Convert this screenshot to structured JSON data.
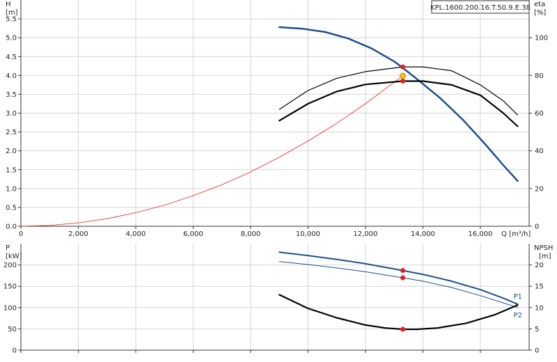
{
  "chart_data": [
    {
      "type": "line",
      "title": "KPL.1600.200.16.T.50.9.E.38",
      "xlabel": "Q [m³/h]",
      "ylabel_unit_left": "[m]",
      "ylabel_left": "H",
      "ylabel_right": "eta",
      "ylabel_unit_right": "[%]",
      "xlim": [
        0,
        17700
      ],
      "ylim_left": [
        0,
        6.0
      ],
      "ylim_right": [
        0,
        120
      ],
      "x_ticks": [
        0,
        2000,
        4000,
        6000,
        8000,
        10000,
        12000,
        14000,
        16000
      ],
      "x_tick_labels": [
        "0",
        "2,000",
        "4,000",
        "6,000",
        "8,000",
        "10,000",
        "12,000",
        "14,000",
        "16,000"
      ],
      "y_ticks_left": [
        0.0,
        0.5,
        1.0,
        1.5,
        2.0,
        2.5,
        3.0,
        3.5,
        4.0,
        4.5,
        5.0,
        5.5
      ],
      "y_tick_labels_left": [
        "0.0",
        "0.5",
        "1.0",
        "1.5",
        "2.0",
        "2.5",
        "3.0",
        "3.5",
        "4.0",
        "4.5",
        "5.0",
        "5.5"
      ],
      "y_ticks_right": [
        0,
        20,
        40,
        60,
        80,
        100
      ],
      "y_tick_labels_right": [
        "0",
        "20",
        "40",
        "60",
        "80",
        "100"
      ],
      "grid": true,
      "series": [
        {
          "axis": "left",
          "color": "#1a4f8c",
          "width": 2.5,
          "x": [
            9000,
            9800,
            10600,
            11400,
            12200,
            13000,
            13300,
            13800,
            14600,
            15400,
            16200,
            16800,
            17300
          ],
          "y": [
            5.28,
            5.24,
            5.15,
            4.98,
            4.72,
            4.37,
            4.2,
            3.9,
            3.4,
            2.82,
            2.15,
            1.62,
            1.2
          ]
        },
        {
          "axis": "left",
          "color": "#e62020",
          "width": 0.8,
          "x": [
            0,
            1000,
            2000,
            3000,
            4000,
            5000,
            6000,
            7000,
            8000,
            9000,
            10000,
            11000,
            12000,
            13300
          ],
          "y": [
            0,
            0.02,
            0.09,
            0.2,
            0.36,
            0.56,
            0.81,
            1.1,
            1.44,
            1.83,
            2.26,
            2.73,
            3.25,
            3.99
          ]
        },
        {
          "axis": "right",
          "color": "#000000",
          "width": 1.2,
          "x": [
            9000,
            10000,
            11000,
            12000,
            13300,
            14000,
            15000,
            16000,
            16800,
            17300
          ],
          "y": [
            62,
            72,
            78.5,
            82,
            84.5,
            84.5,
            82.5,
            75,
            66.5,
            59
          ]
        },
        {
          "axis": "right",
          "color": "#000000",
          "width": 2.2,
          "x": [
            9000,
            10000,
            11000,
            12000,
            13300,
            14000,
            15000,
            16000,
            16800,
            17300
          ],
          "y": [
            56,
            65,
            71.5,
            75.2,
            77,
            77,
            75,
            69.5,
            60,
            53
          ]
        }
      ],
      "markers": [
        {
          "x": 13300,
          "y": 3.99,
          "axis": "left",
          "color": "#f4c20d",
          "stroke": "#c8860a",
          "r": 4
        },
        {
          "x": 13300,
          "y": 84.5,
          "axis": "right",
          "color": "#e02020",
          "stroke": "#e02020",
          "r": 3
        },
        {
          "x": 13300,
          "y": 77,
          "axis": "right",
          "color": "#e02020",
          "stroke": "#e02020",
          "r": 3
        }
      ]
    },
    {
      "type": "line",
      "xlabel": "",
      "ylabel_left": "P",
      "ylabel_unit_left": "[kW]",
      "ylabel_right": "NPSH",
      "ylabel_unit_right": "[m]",
      "xlim": [
        0,
        17700
      ],
      "ylim_left": [
        0,
        250
      ],
      "ylim_right": [
        0,
        25
      ],
      "x_ticks": [
        0,
        2000,
        4000,
        6000,
        8000,
        10000,
        12000,
        14000,
        16000
      ],
      "y_ticks_left": [
        0,
        50,
        100,
        150,
        200
      ],
      "y_tick_labels_left": [
        "0",
        "50",
        "100",
        "150",
        "200"
      ],
      "y_ticks_right": [
        0,
        5,
        10,
        15,
        20
      ],
      "y_tick_labels_right": [
        "0",
        "5",
        "10",
        "15",
        "20"
      ],
      "grid": true,
      "series": [
        {
          "name": "P1",
          "axis": "left",
          "color": "#1a4f8c",
          "width": 2.0,
          "x": [
            9000,
            10000,
            11000,
            12000,
            13300,
            14000,
            15000,
            16000,
            16800,
            17300
          ],
          "y": [
            230,
            222,
            213,
            203,
            187,
            178,
            162,
            142,
            122,
            108
          ]
        },
        {
          "name": "P2",
          "axis": "left",
          "color": "#1a4f8c",
          "width": 1.0,
          "x": [
            9000,
            10000,
            11000,
            12000,
            13300,
            14000,
            15000,
            16000,
            16800,
            17300
          ],
          "y": [
            208,
            201,
            193,
            184,
            170,
            162,
            147,
            128,
            111,
            100
          ]
        },
        {
          "axis": "right",
          "color": "#000000",
          "width": 2.2,
          "x": [
            9000,
            10000,
            11000,
            12000,
            12700,
            13300,
            13800,
            14500,
            15500,
            16500,
            17300
          ],
          "y": [
            13,
            9.8,
            7.6,
            5.9,
            5.2,
            4.9,
            4.9,
            5.2,
            6.3,
            8.3,
            10.6
          ]
        }
      ],
      "markers": [
        {
          "x": 13300,
          "y": 187,
          "axis": "left",
          "color": "#e02020",
          "stroke": "#e02020",
          "r": 3
        },
        {
          "x": 13300,
          "y": 170,
          "axis": "left",
          "color": "#e02020",
          "stroke": "#e02020",
          "r": 3
        },
        {
          "x": 13300,
          "y": 4.9,
          "axis": "right",
          "color": "#e02020",
          "stroke": "#e02020",
          "r": 3
        }
      ]
    }
  ]
}
